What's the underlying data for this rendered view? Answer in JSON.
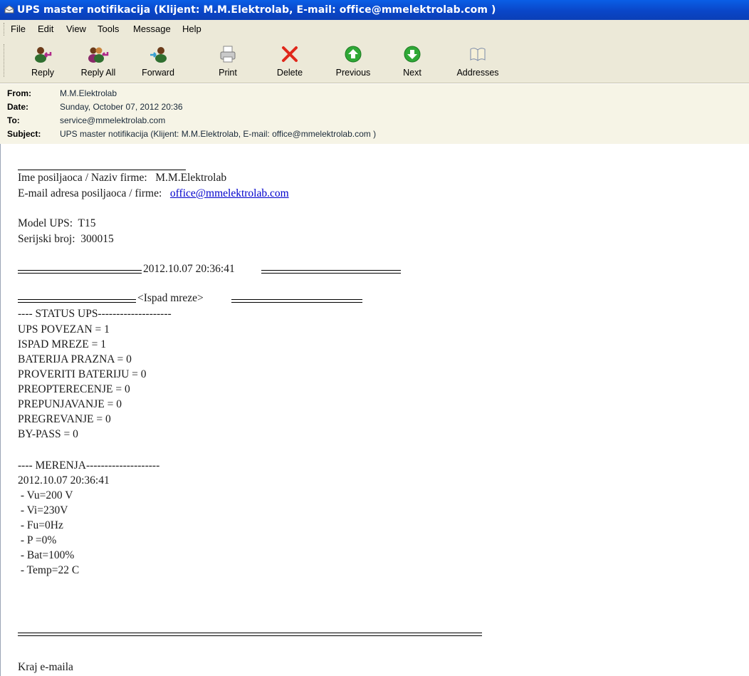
{
  "window": {
    "title": "UPS master notifikacija (Klijent: M.M.Elektrolab, E-mail: office@mmelektrolab.com )"
  },
  "menu": [
    "File",
    "Edit",
    "View",
    "Tools",
    "Message",
    "Help"
  ],
  "toolbar": {
    "reply": "Reply",
    "reply_all": "Reply All",
    "forward": "Forward",
    "print": "Print",
    "delete": "Delete",
    "previous": "Previous",
    "next": "Next",
    "addresses": "Addresses"
  },
  "header": {
    "from_label": "From:",
    "from": "M.M.Elektrolab",
    "date_label": "Date:",
    "date": "Sunday, October 07, 2012 20:36",
    "to_label": "To:",
    "to": "service@mmelektrolab.com",
    "subject_label": "Subject:",
    "subject": "UPS master notifikacija (Klijent: M.M.Elektrolab, E-mail: office@mmelektrolab.com )"
  },
  "message": {
    "sender_line": "Ime posiljaoca / Naziv firme:   M.M.Elektrolab",
    "email_label": "E-mail adresa posiljaoca / firme:   ",
    "email_link": "office@mmelektrolab.com",
    "model": "Model UPS:  T15",
    "serial": "Serijski broj:  300015",
    "timestamp_header": "2012.10.07 20:36:41",
    "event": "<Ispad mreze>",
    "status_title": "---- STATUS UPS--------------------",
    "status_lines": [
      "UPS POVEZAN = 1",
      "ISPAD MREZE = 1",
      "BATERIJA PRAZNA = 0",
      "PROVERITI BATERIJU = 0",
      "PREOPTERECENJE = 0",
      "PREPUNJAVANJE = 0",
      "PREGREVANJE = 0",
      "BY-PASS = 0"
    ],
    "measure_title": "---- MERENJA--------------------",
    "measure_time": "2012.10.07 20:36:41",
    "measure_lines": [
      " - Vu=200 V",
      " - Vi=230V",
      " - Fu=0Hz",
      " - P =0%",
      " - Bat=100%",
      " - Temp=22 C"
    ],
    "footer": "Kraj e-maila"
  }
}
